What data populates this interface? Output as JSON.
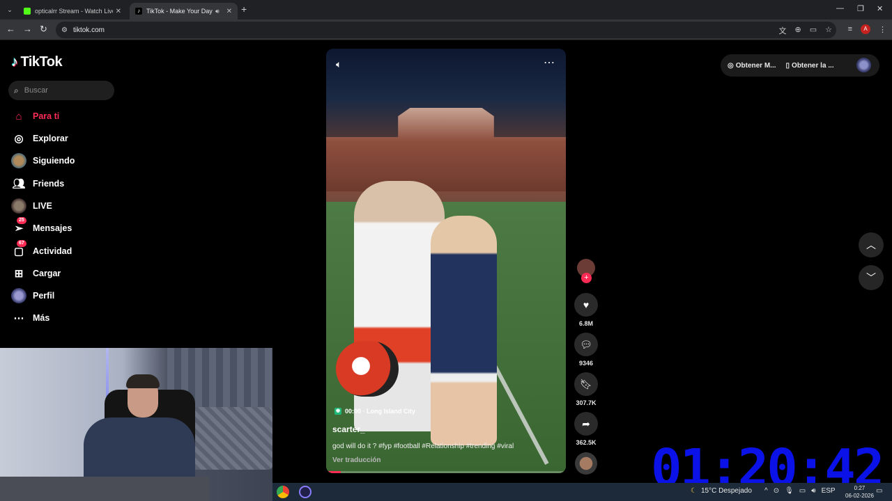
{
  "browser": {
    "tabs": [
      {
        "label": "opticalrr Stream - Watch Live o...",
        "favicon_color": "#53fc18"
      },
      {
        "label": "TikTok - Make Your Day",
        "favicon_color": "#ffffff",
        "active": true
      }
    ],
    "url": "tiktok.com"
  },
  "sidebar": {
    "logo": "TikTok",
    "search_placeholder": "Buscar",
    "items": [
      {
        "label": "Para ti",
        "icon": "home-icon",
        "active": true
      },
      {
        "label": "Explorar",
        "icon": "compass-icon"
      },
      {
        "label": "Siguiendo",
        "icon": "avatar"
      },
      {
        "label": "Friends",
        "icon": "friends-icon"
      },
      {
        "label": "LIVE",
        "icon": "avatar"
      },
      {
        "label": "Mensajes",
        "icon": "send-icon",
        "badge": "25"
      },
      {
        "label": "Actividad",
        "icon": "inbox-icon",
        "badge": "67"
      },
      {
        "label": "Cargar",
        "icon": "plus-square-icon"
      },
      {
        "label": "Perfil",
        "icon": "avatar"
      },
      {
        "label": "Más",
        "icon": "more-icon"
      }
    ]
  },
  "video": {
    "location_time": "00:00 · Long Island City",
    "author": "scarter_",
    "caption": "god will do it ? #fyp #football #Relationship #trending #viral",
    "translate_link": "Ver traducción",
    "progress": 0.06
  },
  "actions": {
    "likes": "6.8M",
    "comments": "9346",
    "saves": "307.7K",
    "shares": "362.5K"
  },
  "topbar": {
    "get_coins": "Obtener M...",
    "get_app": "Obtener la ..."
  },
  "overlay": {
    "timer": "01:20:42"
  },
  "taskbar": {
    "weather": "15°C  Despejado",
    "lang": "ESP",
    "time": "0:27",
    "date": "06-02-2026"
  },
  "colors": {
    "accent": "#fe2c55",
    "timer": "#0a12e8"
  }
}
